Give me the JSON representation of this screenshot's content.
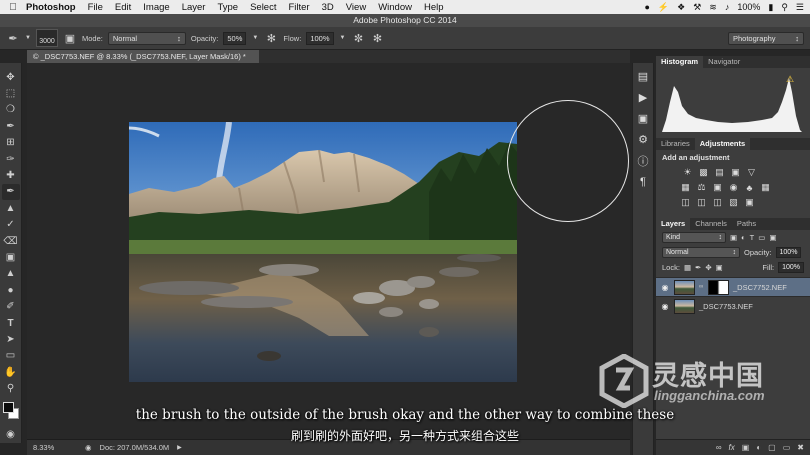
{
  "menubar": {
    "app": "Photoshop",
    "items": [
      "File",
      "Edit",
      "Image",
      "Layer",
      "Type",
      "Select",
      "Filter",
      "3D",
      "View",
      "Window",
      "Help"
    ],
    "battery": "100%",
    "status_icons": [
      "evernote-icon",
      "flash-icon",
      "dropbox-icon",
      "tools-icon",
      "wifi-icon",
      "volume-icon",
      "battery-icon",
      "search-icon",
      "list-icon"
    ]
  },
  "window": {
    "title": "Adobe Photoshop CC 2014"
  },
  "options": {
    "brush_size": "3000",
    "mode_label": "Mode:",
    "mode_value": "Normal",
    "opacity_label": "Opacity:",
    "opacity_value": "50%",
    "flow_label": "Flow:",
    "flow_value": "100%",
    "workspace": "Photography"
  },
  "document": {
    "tab": "© _DSC7753.NEF @ 8.33% (_DSC7753.NEF, Layer Mask/16) *",
    "zoom": "8.33%",
    "doc_info": "Doc: 207.0M/534.0M"
  },
  "panels": {
    "histogram_tabs": [
      "Histogram",
      "Navigator"
    ],
    "adjust_tabs": [
      "Libraries",
      "Adjustments"
    ],
    "adjust_heading": "Add an adjustment",
    "layers_tabs": [
      "Layers",
      "Channels",
      "Paths"
    ],
    "kind_label": "Kind",
    "blend_mode": "Normal",
    "opacity_label": "Opacity:",
    "opacity_value": "100%",
    "lock_label": "Lock:",
    "fill_label": "Fill:",
    "fill_value": "100%",
    "layers": [
      {
        "name": "_DSC7752.NEF",
        "has_mask": true,
        "selected": true
      },
      {
        "name": "_DSC7753.NEF",
        "has_mask": false,
        "selected": false
      }
    ],
    "footer_icons": [
      "link-icon",
      "fx-icon",
      "mask-icon",
      "adjustment-icon",
      "folder-icon",
      "new-layer-icon",
      "trash-icon"
    ]
  },
  "subtitles": {
    "en": "the brush to the outside of the brush okay and the other way to combine these",
    "cn": "刷到刷的外面好吧，另一种方式来组合这些"
  },
  "watermark": {
    "cn": "灵感中国",
    "url": "lingganchina.com"
  },
  "colors": {
    "foreground": "#0b0b0b",
    "background": "#ffffff",
    "selected_layer": "#5d6f86"
  }
}
